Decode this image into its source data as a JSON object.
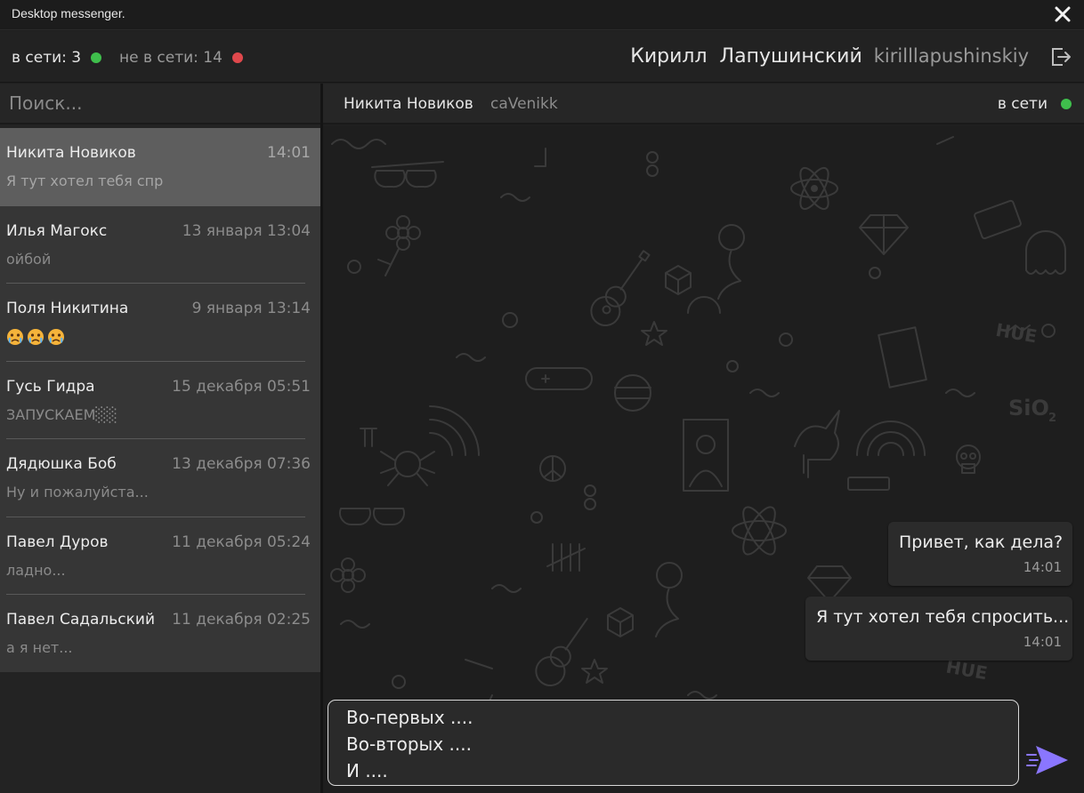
{
  "app": {
    "title": "Desktop messenger.",
    "accent": "#8a76ff",
    "online_color": "#3fbf4c",
    "offline_color": "#e0484c"
  },
  "topbar": {
    "online_label": "в сети: 3",
    "offline_label": "не в сети: 14",
    "user_fullname": "Кирилл  Лапушинский",
    "user_username": "kirilllapushinskiy"
  },
  "search": {
    "placeholder": "Поиск..."
  },
  "chats": [
    {
      "name": "Никита Новиков",
      "time": "14:01",
      "preview": "Я тут хотел тебя спр",
      "active": true
    },
    {
      "name": "Илья Магокс",
      "time": "13 января 13:04",
      "preview": "ойбой"
    },
    {
      "name": "Поля Никитина",
      "time": "9 января 13:14",
      "preview_icons": [
        "sad-face-emoji",
        "sad-face-emoji",
        "sad-face-emoji"
      ]
    },
    {
      "name": "Гусь Гидра",
      "time": "15 декабря 05:51",
      "preview": "ЗАПУСКАЕМ░░"
    },
    {
      "name": "Дядюшка Боб",
      "time": "13 декабря 07:36",
      "preview": "Ну и пожалуйста..."
    },
    {
      "name": "Павел Дуров",
      "time": "11 декабря 05:24",
      "preview": "ладно..."
    },
    {
      "name": "Павел Садальский",
      "time": "11 декабря 02:25",
      "preview": "а я нет..."
    }
  ],
  "chat": {
    "peer_name": "Никита Новиков",
    "peer_username": "caVenikk",
    "peer_status": "в сети",
    "messages": [
      {
        "text": "Привет, как дела?",
        "time": "14:01",
        "outgoing": true
      },
      {
        "text": "Я тут хотел тебя спросить...",
        "time": "14:01",
        "outgoing": true
      }
    ]
  },
  "composer": {
    "value": "Во-первых ....\nВо-вторых ....\nИ ...."
  },
  "icons": {
    "close": "close-icon",
    "logout": "logout-icon",
    "send": "send-icon"
  }
}
